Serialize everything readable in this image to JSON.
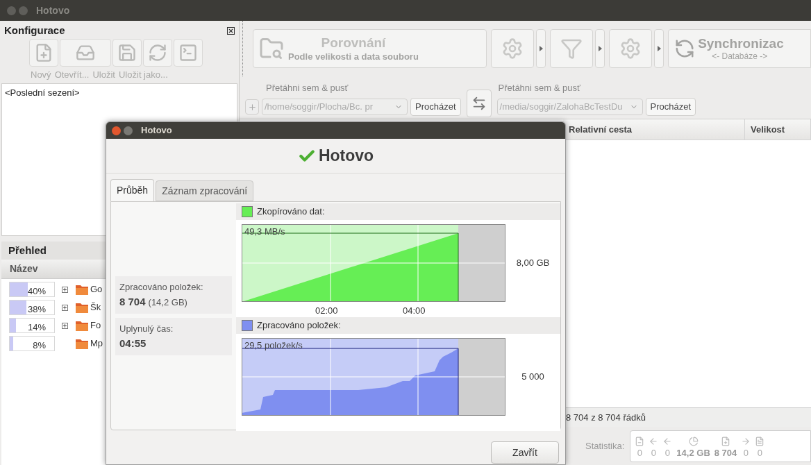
{
  "window": {
    "title": "Hotovo"
  },
  "config_panel": {
    "title": "Konfigurace",
    "toolbar": [
      {
        "label": "Nový",
        "disabled": true
      },
      {
        "label": "Otevřít...",
        "disabled": true
      },
      {
        "label": "Uložit",
        "disabled": true
      },
      {
        "label": "Uložit jako...",
        "disabled": true
      },
      {
        "disabled": true
      }
    ],
    "sessions": [
      {
        "label": "<Poslední sezení>",
        "selected": false
      }
    ]
  },
  "overview": {
    "title": "Přehled",
    "column": "Název",
    "rows": [
      {
        "percent": "40%",
        "level": 0.4,
        "expandable": true,
        "name": "Go"
      },
      {
        "percent": "38%",
        "level": 0.38,
        "expandable": true,
        "name": "Šk"
      },
      {
        "percent": "14%",
        "level": 0.14,
        "expandable": true,
        "name": "Fo"
      },
      {
        "percent": "8%",
        "level": 0.08,
        "expandable": false,
        "name": "Mp"
      }
    ]
  },
  "toolbar": {
    "compare": {
      "title": "Porovnání",
      "subtitle": "Podle velikosti a data souboru",
      "disabled": true
    },
    "tools": [
      {
        "kind": "gear",
        "disabled": true
      },
      {
        "kind": "filter",
        "disabled": true
      },
      {
        "kind": "gear",
        "disabled": true
      }
    ],
    "sync": {
      "title": "Synchronizac",
      "subtitle": "<- Databáze ->",
      "disabled": true
    }
  },
  "folders": [
    {
      "hint": "Přetáhni sem & pusť",
      "path": "/home/soggir/Plocha/Bc. pr",
      "browse": "Procházet"
    },
    {
      "hint": "Přetáhni sem & pusť",
      "path": "/media/soggir/ZalohaBcTestDu",
      "browse": "Procházet"
    }
  ],
  "file_table": {
    "columns": [
      "Relativní cesta",
      "Velikost"
    ],
    "row_count": "8 704 z 8 704 řádků"
  },
  "statistics": {
    "label": "Statistika:",
    "values": [
      "0",
      "0",
      "0",
      "14,2 GB",
      "8 704",
      "0",
      "0"
    ]
  },
  "dialog": {
    "title": "Hotovo",
    "heading": "Hotovo",
    "tabs": [
      {
        "label": "Průběh",
        "selected": true
      },
      {
        "label": "Záznam zpracování",
        "selected": false
      }
    ],
    "stats": [
      {
        "label": "Zpracováno položek:",
        "value": "8 704",
        "detail": "(14,2 GB)"
      },
      {
        "label": "Uplynulý čas:",
        "value": "04:55"
      }
    ],
    "graphs": [
      {
        "kind": "linear",
        "legend": "Zkopírováno dat:",
        "color": "#66ee55",
        "rate": "49,3 MB/s",
        "axis_label": "8,00 GB",
        "ticks": [
          "02:00",
          "04:00"
        ]
      },
      {
        "kind": "steps",
        "legend": "Zpracováno položek:",
        "color": "#7f8ff0",
        "rate": "29,5 položek/s",
        "axis_label": "5 000"
      }
    ],
    "close": "Zavřít"
  }
}
